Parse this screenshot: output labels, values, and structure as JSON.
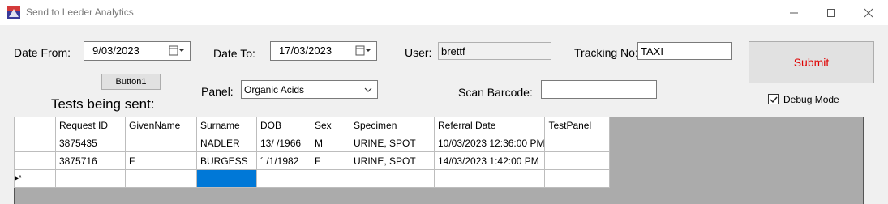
{
  "window": {
    "title": "Send to Leeder Analytics"
  },
  "form": {
    "date_from_label": "Date From:",
    "date_from_value": "9/03/2023",
    "date_to_label": "Date To:",
    "date_to_value": "17/03/2023",
    "user_label": "User:",
    "user_value": "brettf",
    "tracking_label": "Tracking No:",
    "tracking_value": "TAXI",
    "submit_label": "Submit",
    "button1_label": "Button1",
    "panel_label": "Panel:",
    "panel_value": "Organic Acids",
    "scan_label": "Scan Barcode:",
    "scan_value": "",
    "debug_label": "Debug Mode",
    "debug_checked": true,
    "tests_title": "Tests being sent:"
  },
  "grid": {
    "columns": [
      "Request ID",
      "GivenName",
      "Surname",
      "DOB",
      "Sex",
      "Specimen",
      "Referral Date",
      "TestPanel"
    ],
    "rows": [
      [
        "3875435",
        "",
        "NADLER",
        "13/    /1966",
        "M",
        "URINE, SPOT",
        "10/03/2023 12:36:00 PM",
        ""
      ],
      [
        "3875716",
        "F",
        "BURGESS",
        "´ /1/1982",
        "F",
        "URINE, SPOT",
        "14/03/2023 1:42:00 PM",
        ""
      ]
    ],
    "new_row_marker": "▸*"
  },
  "colors": {
    "submit_text": "#e00000",
    "selection": "#0078d7",
    "grid_background": "#ababab"
  }
}
